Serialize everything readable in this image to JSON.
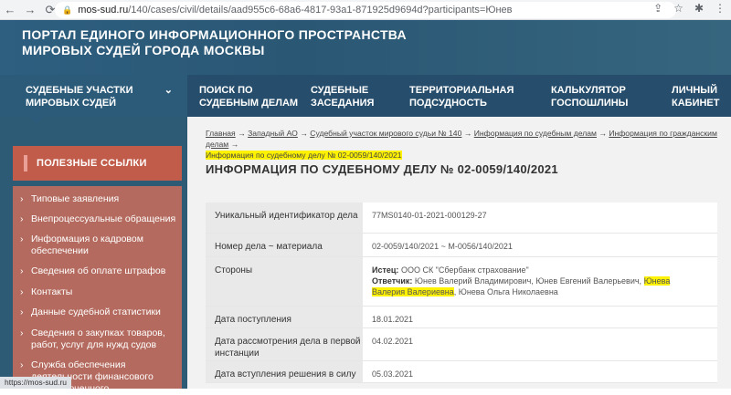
{
  "browser": {
    "url_host": "mos-sud.ru",
    "url_path": "/140/cases/civil/details/aad955c6-68a6-4817-93a1-871925d9694d?participants=Юнев",
    "status_url": "https://mos-sud.ru"
  },
  "header": {
    "title_line1": "ПОРТАЛ ЕДИНОГО ИНФОРМАЦИОННОГО ПРОСТРАНСТВА",
    "title_line2": "МИРОВЫХ СУДЕЙ ГОРОДА МОСКВЫ"
  },
  "nav": {
    "items": [
      {
        "line1": "СУДЕБНЫЕ УЧАСТКИ",
        "line2": "МИРОВЫХ СУДЕЙ"
      },
      {
        "line1": "ПОИСК ПО",
        "line2": "СУДЕБНЫМ ДЕЛАМ"
      },
      {
        "line1": "СУДЕБНЫЕ",
        "line2": "ЗАСЕДАНИЯ"
      },
      {
        "line1": "ТЕРРИТОРИАЛЬНАЯ",
        "line2": "ПОДСУДНОСТЬ"
      },
      {
        "line1": "КАЛЬКУЛЯТОР",
        "line2": "ГОСПОШЛИНЫ"
      },
      {
        "line1": "ЛИЧНЫЙ",
        "line2": "КАБИНЕТ"
      }
    ]
  },
  "sidebar": {
    "section_title": "ПОЛЕЗНЫЕ ССЫЛКИ",
    "links": [
      [
        "Типовые заявления"
      ],
      [
        "Внепроцессуальные обращения"
      ],
      [
        "Информация о кадровом",
        "обеспечении"
      ],
      [
        "Сведения об оплате штрафов"
      ],
      [
        "Контакты"
      ],
      [
        "Данные судебной статистики"
      ],
      [
        "Сведения о закупках товаров,",
        "работ, услуг для нужд судов"
      ],
      [
        "Служба обеспечения",
        "деятельности финансового",
        "уполномоченного"
      ]
    ]
  },
  "breadcrumbs": {
    "items": [
      "Главная",
      "Западный АО",
      "Судебный участок мирового судьи № 140",
      "Информация по судебным делам",
      "Информация по гражданским делам"
    ],
    "current": "Информация по судебному делу № 02-0059/140/2021",
    "separator": "→"
  },
  "page": {
    "title": "ИНФОРМАЦИЯ ПО СУДЕБНОМУ ДЕЛУ № 02-0059/140/2021"
  },
  "details": {
    "uid_label": "Уникальный идентификатор дела",
    "uid_value": "77MS0140-01-2021-000129-27",
    "case_label": "Номер дела ~ материала",
    "case_value": "02-0059/140/2021 ~ М-0056/140/2021",
    "parties_label": "Стороны",
    "plaintiff_label": "Истец:",
    "plaintiff_value": "ООО СК \"Сбербанк страхование\"",
    "defendant_label": "Ответчик:",
    "defendant_value_a": "Юнев Валерий Владимирович, Юнев Евгений Валерьевич,",
    "defendant_value_hl1": "Юнева",
    "defendant_value_hl2": "Валерия Валериевна",
    "defendant_value_b": ", Юнева Ольга Николаевна",
    "received_label": "Дата поступления",
    "received_value": "18.01.2021",
    "hearing_label": "Дата рассмотрения дела в первой инстанции",
    "hearing_value": "04.02.2021",
    "effective_label": "Дата вступления решения в силу",
    "effective_value": "05.03.2021"
  }
}
